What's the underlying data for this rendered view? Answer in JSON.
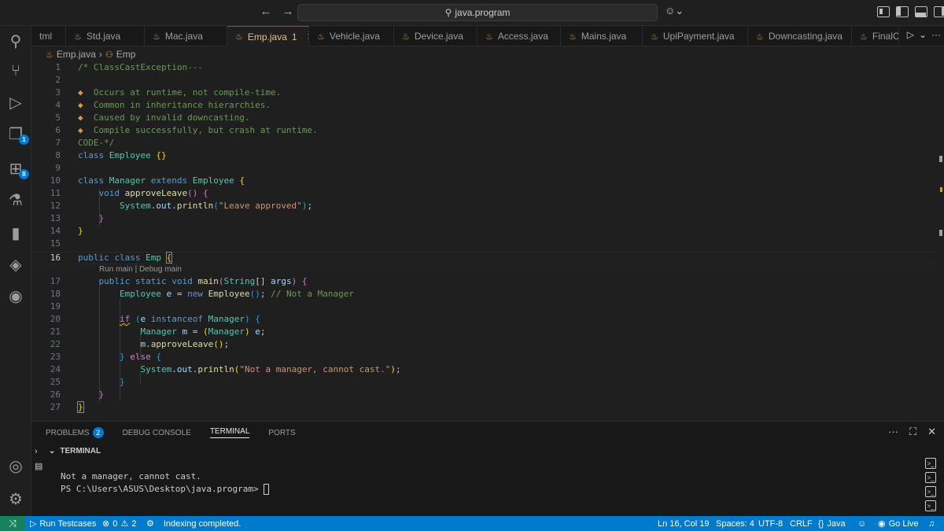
{
  "titlebar": {
    "search_text": "java.program"
  },
  "activity": {
    "source_control_badge": "1",
    "extensions_badge": "8"
  },
  "tabs": [
    {
      "label": "tml"
    },
    {
      "label": "Std.java"
    },
    {
      "label": "Mac.java"
    },
    {
      "label": "Emp.java",
      "problems": "1"
    },
    {
      "label": "Vehicle.java"
    },
    {
      "label": "Device.java"
    },
    {
      "label": "Access.java"
    },
    {
      "label": "Mains.java"
    },
    {
      "label": "UpiPayment.java"
    },
    {
      "label": "Downcasting.java"
    },
    {
      "label": "FinalC"
    }
  ],
  "breadcrumb": {
    "file": "Emp.java",
    "symbol": "Emp"
  },
  "editor": {
    "codelens": "Run main | Debug main",
    "lines": {
      "l1": "/* ClassCastException---",
      "l3": "Occurs at runtime, not compile-time.",
      "l4": "Common in inheritance hierarchies.",
      "l5": "Caused by invalid downcasting.",
      "l6": "Compile successfully, but crash at runtime.",
      "l7": "CODE-*/",
      "l12_str": "\"Leave approved\"",
      "l18_comment": "// Not a Manager",
      "l24_str": "\"Not a manager, cannot cast.\""
    }
  },
  "panel": {
    "tabs": [
      "Problems",
      "Debug Console",
      "Terminal",
      "Ports"
    ],
    "problems_count": "2",
    "terminal_header": "TERMINAL",
    "output_line": "Not a manager, cannot cast.",
    "prompt": "PS C:\\Users\\ASUS\\Desktop\\java.program> "
  },
  "statusbar": {
    "run_testcases": "Run Testcases",
    "errors": "0",
    "warnings": "2",
    "indexing": "Indexing completed.",
    "position": "Ln 16, Col 19",
    "spaces": "Spaces: 4",
    "encoding": "UTF-8",
    "eol": "CRLF",
    "language": "Java",
    "go_live": "Go Live"
  },
  "colors": {
    "status_bar": "#007acc",
    "remote": "#16825d",
    "active_tab_text": "#e2c08d",
    "keyword": "#569cd6",
    "type": "#4ec9b0",
    "function": "#dcdcaa",
    "string": "#ce9178",
    "comment": "#6a9955"
  }
}
